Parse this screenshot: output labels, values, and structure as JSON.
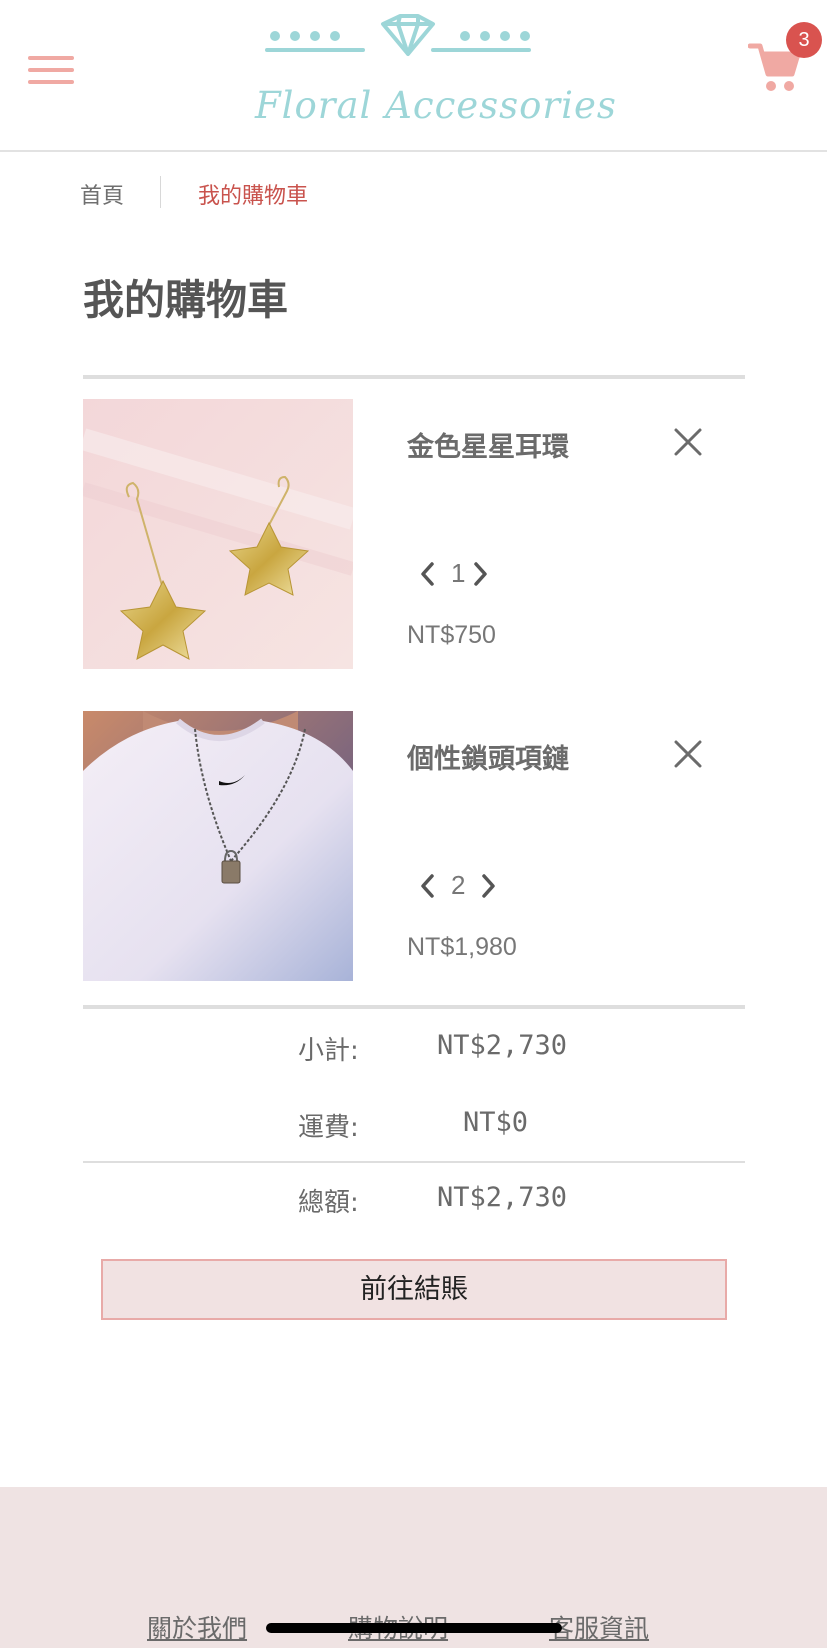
{
  "header": {
    "logo_text": "Floral Accessories",
    "cart_count": "3",
    "accent_color": "#9dd6d8",
    "brand_pink": "#f0a9a3"
  },
  "breadcrumb": {
    "home": "首頁",
    "current": "我的購物車"
  },
  "page_title": "我的購物車",
  "cart_items": [
    {
      "name": "金色星星耳環",
      "quantity": "1",
      "price": "NT$750",
      "image": "gold-star-earrings-photo"
    },
    {
      "name": "個性鎖頭項鏈",
      "quantity": "2",
      "price": "NT$1,980",
      "image": "lock-necklace-photo"
    }
  ],
  "summary": {
    "subtotal_label": "小計:",
    "subtotal_value": "NT$2,730",
    "shipping_label": "運費:",
    "shipping_value": "NT$0",
    "total_label": "總額:",
    "total_value": "NT$2,730"
  },
  "checkout_label": "前往結賬",
  "footer": {
    "links": [
      "關於我們",
      "購物說明",
      "客服資訊"
    ]
  }
}
